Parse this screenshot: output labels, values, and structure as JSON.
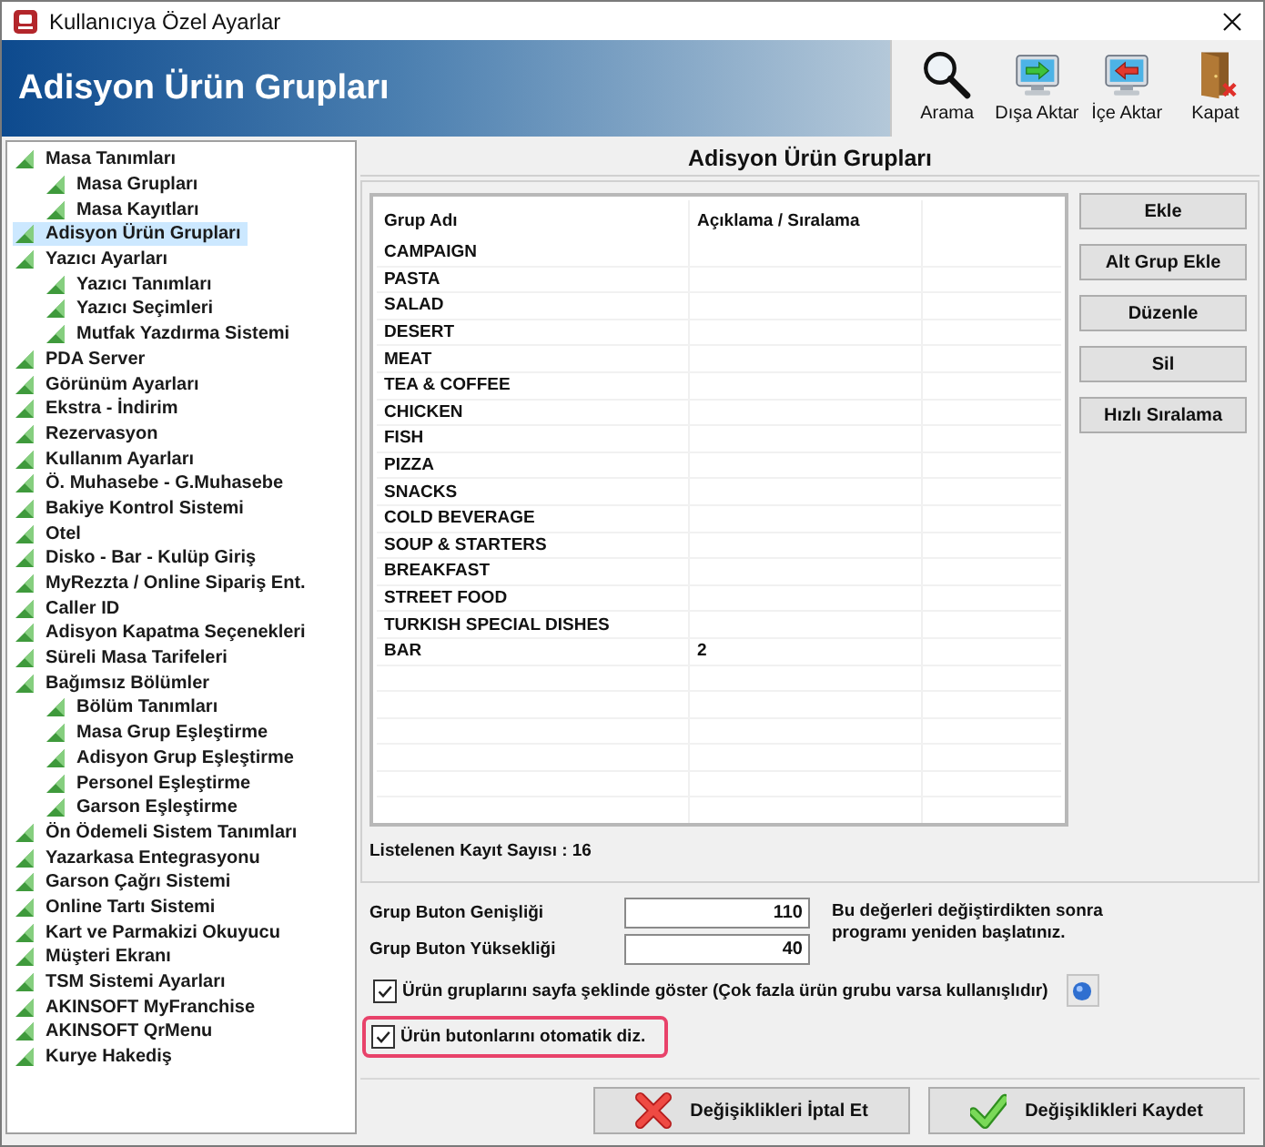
{
  "window": {
    "title": "Kullanıcıya Özel Ayarlar"
  },
  "header": {
    "title": "Adisyon Ürün Grupları"
  },
  "toolbar": [
    {
      "label": "Arama",
      "kind": "search"
    },
    {
      "label": "Dışa Aktar",
      "kind": "export"
    },
    {
      "label": "İçe Aktar",
      "kind": "import"
    },
    {
      "label": "Kapat",
      "kind": "close"
    }
  ],
  "tree": [
    {
      "label": "Masa Tanımları",
      "selected": false,
      "children": [
        {
          "label": "Masa Grupları",
          "selected": false
        },
        {
          "label": "Masa Kayıtları",
          "selected": false
        }
      ]
    },
    {
      "label": "Adisyon Ürün Grupları",
      "selected": true
    },
    {
      "label": "Yazıcı Ayarları",
      "selected": false,
      "children": [
        {
          "label": "Yazıcı Tanımları",
          "selected": false
        },
        {
          "label": "Yazıcı Seçimleri",
          "selected": false
        },
        {
          "label": "Mutfak Yazdırma Sistemi",
          "selected": false
        }
      ]
    },
    {
      "label": "PDA Server",
      "selected": false
    },
    {
      "label": "Görünüm Ayarları",
      "selected": false
    },
    {
      "label": "Ekstra - İndirim",
      "selected": false
    },
    {
      "label": "Rezervasyon",
      "selected": false
    },
    {
      "label": "Kullanım Ayarları",
      "selected": false
    },
    {
      "label": "Ö. Muhasebe - G.Muhasebe",
      "selected": false
    },
    {
      "label": "Bakiye Kontrol Sistemi",
      "selected": false
    },
    {
      "label": "Otel",
      "selected": false
    },
    {
      "label": "Disko - Bar - Kulüp Giriş",
      "selected": false
    },
    {
      "label": "MyRezzta / Online Sipariş Ent.",
      "selected": false
    },
    {
      "label": "Caller ID",
      "selected": false
    },
    {
      "label": "Adisyon Kapatma Seçenekleri",
      "selected": false
    },
    {
      "label": "Süreli Masa Tarifeleri",
      "selected": false
    },
    {
      "label": "Bağımsız Bölümler",
      "selected": false,
      "children": [
        {
          "label": "Bölüm Tanımları",
          "selected": false
        },
        {
          "label": "Masa Grup Eşleştirme",
          "selected": false
        },
        {
          "label": "Adisyon Grup Eşleştirme",
          "selected": false
        },
        {
          "label": "Personel Eşleştirme",
          "selected": false
        },
        {
          "label": "Garson Eşleştirme",
          "selected": false
        }
      ]
    },
    {
      "label": "Ön Ödemeli Sistem Tanımları",
      "selected": false
    },
    {
      "label": "Yazarkasa Entegrasyonu",
      "selected": false
    },
    {
      "label": "Garson Çağrı Sistemi",
      "selected": false
    },
    {
      "label": "Online Tartı Sistemi",
      "selected": false
    },
    {
      "label": "Kart ve Parmakizi Okuyucu",
      "selected": false
    },
    {
      "label": "Müşteri Ekranı",
      "selected": false
    },
    {
      "label": "TSM Sistemi Ayarları",
      "selected": false
    },
    {
      "label": "AKINSOFT MyFranchise",
      "selected": false
    },
    {
      "label": "AKINSOFT QrMenu",
      "selected": false
    },
    {
      "label": "Kurye Hakediş",
      "selected": false
    }
  ],
  "panel": {
    "title": "Adisyon Ürün Grupları"
  },
  "table": {
    "columns": [
      "Grup Adı",
      "Açıklama / Sıralama"
    ],
    "rows": [
      [
        "CAMPAIGN"
      ],
      [
        "PASTA"
      ],
      [
        "SALAD"
      ],
      [
        "DESERT"
      ],
      [
        "MEAT"
      ],
      [
        "TEA & COFFEE"
      ],
      [
        "CHICKEN"
      ],
      [
        "FISH"
      ],
      [
        "PIZZA"
      ],
      [
        "SNACKS"
      ],
      [
        "COLD BEVERAGE"
      ],
      [
        "SOUP & STARTERS"
      ],
      [
        "BREAKFAST"
      ],
      [
        "STREET FOOD"
      ],
      [
        "TURKISH SPECIAL DISHES"
      ],
      [
        "BAR",
        "2"
      ]
    ]
  },
  "record_count": "Listelenen Kayıt Sayısı : 16",
  "side_buttons": [
    "Ekle",
    "Alt Grup Ekle",
    "Düzenle",
    "Sil",
    "Hızlı Sıralama"
  ],
  "settings": [
    {
      "label": "Grup Buton Genişliği",
      "value": "110"
    },
    {
      "label": "Grup Buton Yüksekliği",
      "value": "40"
    }
  ],
  "note": "Bu değerleri değiştirdikten sonra programı yeniden başlatınız.",
  "checkboxes": [
    {
      "label": "Ürün gruplarını sayfa şeklinde göster (Çok fazla ürün grubu varsa kullanışlıdır)",
      "checked": true,
      "help": true,
      "highlighted": false
    },
    {
      "label": "Ürün butonlarını otomatik diz.",
      "checked": true,
      "help": false,
      "highlighted": true
    }
  ],
  "footer_buttons": [
    {
      "label": "Değişiklikleri İptal Et",
      "kind": "cancel"
    },
    {
      "label": "Değişiklikleri Kaydet",
      "kind": "save"
    }
  ]
}
